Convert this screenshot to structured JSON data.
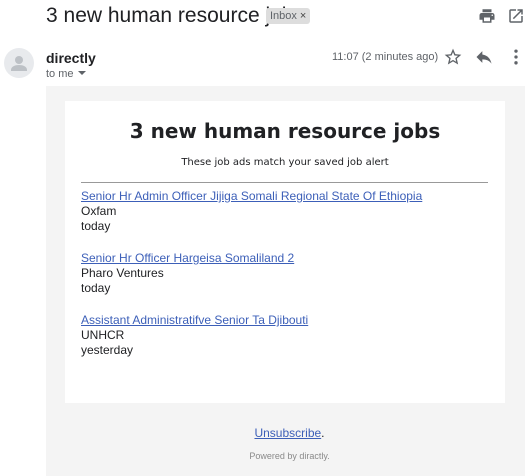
{
  "header": {
    "subject": "3 new human resource jobs",
    "badge_label": "Inbox",
    "badge_close": "×",
    "icons": [
      "print-icon",
      "open-in-new-window-icon"
    ]
  },
  "message": {
    "sender": "directly",
    "recipient_label": "to me",
    "time": "11:07 (2 minutes ago)",
    "icons": [
      "avatar-person-icon",
      "star-icon",
      "reply-icon",
      "more-vert-icon"
    ]
  },
  "email": {
    "title": "3 new human resource jobs",
    "subtitle": "These job ads match your saved job alert",
    "jobs": [
      {
        "title": "Senior Hr Admin Officer Jijiga Somali Regional State Of Ethiopia",
        "company": "Oxfam",
        "date": "today"
      },
      {
        "title": "Senior Hr Officer Hargeisa Somaliland 2",
        "company": "Pharo Ventures",
        "date": "today"
      },
      {
        "title": "Assistant Administratifve Senior Ta Djibouti",
        "company": "UNHCR",
        "date": "yesterday"
      }
    ],
    "unsubscribe_label": "Unsubscribe",
    "unsubscribe_suffix": ".",
    "powered_by": "Powered by diractly."
  },
  "colors": {
    "link": "#3c5fb8",
    "background": "#f4f4f4",
    "card": "#ffffff",
    "badge": "#dddddd"
  }
}
